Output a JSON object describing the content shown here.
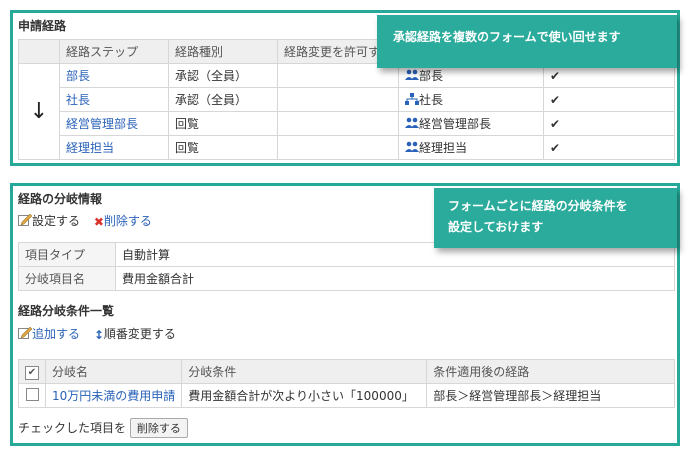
{
  "panel1": {
    "title": "申請経路",
    "callout": "承認経路を複数のフォームで使い回せます",
    "columns": [
      "経路ステップ",
      "経路種別",
      "経路変更を許可する"
    ],
    "rows": [
      {
        "step": "部長",
        "type": "承認（全員）",
        "approver": "部長",
        "mark": "✔"
      },
      {
        "step": "社長",
        "type": "承認（全員）",
        "approver": "社長",
        "mark": "✔"
      },
      {
        "step": "経営管理部長",
        "type": "回覧",
        "approver": "経営管理部長",
        "mark": "✔"
      },
      {
        "step": "経理担当",
        "type": "回覧",
        "approver": "経理担当",
        "mark": "✔"
      }
    ],
    "arrow": "↓"
  },
  "panel2": {
    "title": "経路の分岐情報",
    "callout_line1": "フォームごとに経路の分岐条件を",
    "callout_line2": "設定しておけます",
    "settings_label": "設定する",
    "delete_label": "削除する",
    "info": [
      {
        "key": "項目タイプ",
        "value": "自動計算"
      },
      {
        "key": "分岐項目名",
        "value": "費用金額合計"
      }
    ],
    "conditions_title": "経路分岐条件一覧",
    "add_label": "追加する",
    "reorder_label": "順番変更する",
    "cond_columns": [
      "分岐名",
      "分岐条件",
      "条件適用後の経路"
    ],
    "cond_rows": [
      {
        "name": "10万円未満の費用申請",
        "condition": "費用金額合計が次より小さい「100000」",
        "route": "部長＞経営管理部長＞経理担当"
      }
    ],
    "checked_label": "チェックした項目を",
    "checked_delete_button": "削除する"
  },
  "colors": {
    "accent": "#27a99a",
    "link": "#2a62b8"
  }
}
